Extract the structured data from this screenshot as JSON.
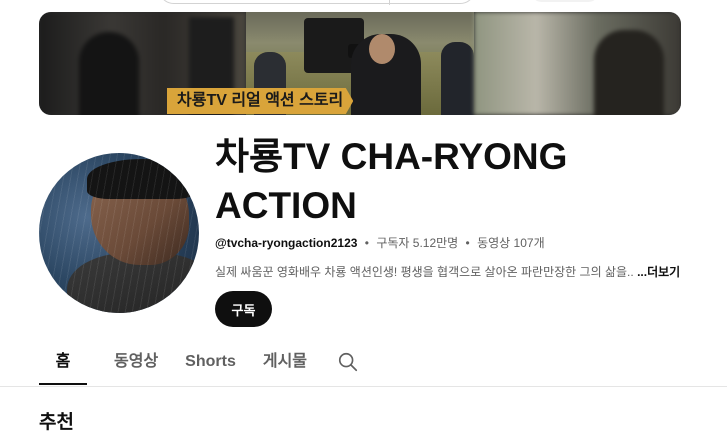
{
  "banner": {
    "tagline": "차룡TV 리얼 액션 스토리"
  },
  "channel": {
    "name": "차룡TV CHA-RYONG ACTION",
    "handle": "@tvcha-ryongaction2123",
    "subscribers": "구독자 5.12만명",
    "videos": "동영상 107개",
    "separator": "•",
    "description": "실제 싸움꾼 영화배우 차룡 액션인생! 평생을 협객으로 살아온 파란만장한 그의 삶을..",
    "more_label": "...더보기",
    "subscribe_label": "구독"
  },
  "tabs": [
    {
      "label": "홈",
      "active": true
    },
    {
      "label": "동영상",
      "active": false
    },
    {
      "label": "Shorts",
      "active": false
    },
    {
      "label": "게시물",
      "active": false
    }
  ],
  "tab_search_icon": "search-icon",
  "section": {
    "title": "추천"
  }
}
